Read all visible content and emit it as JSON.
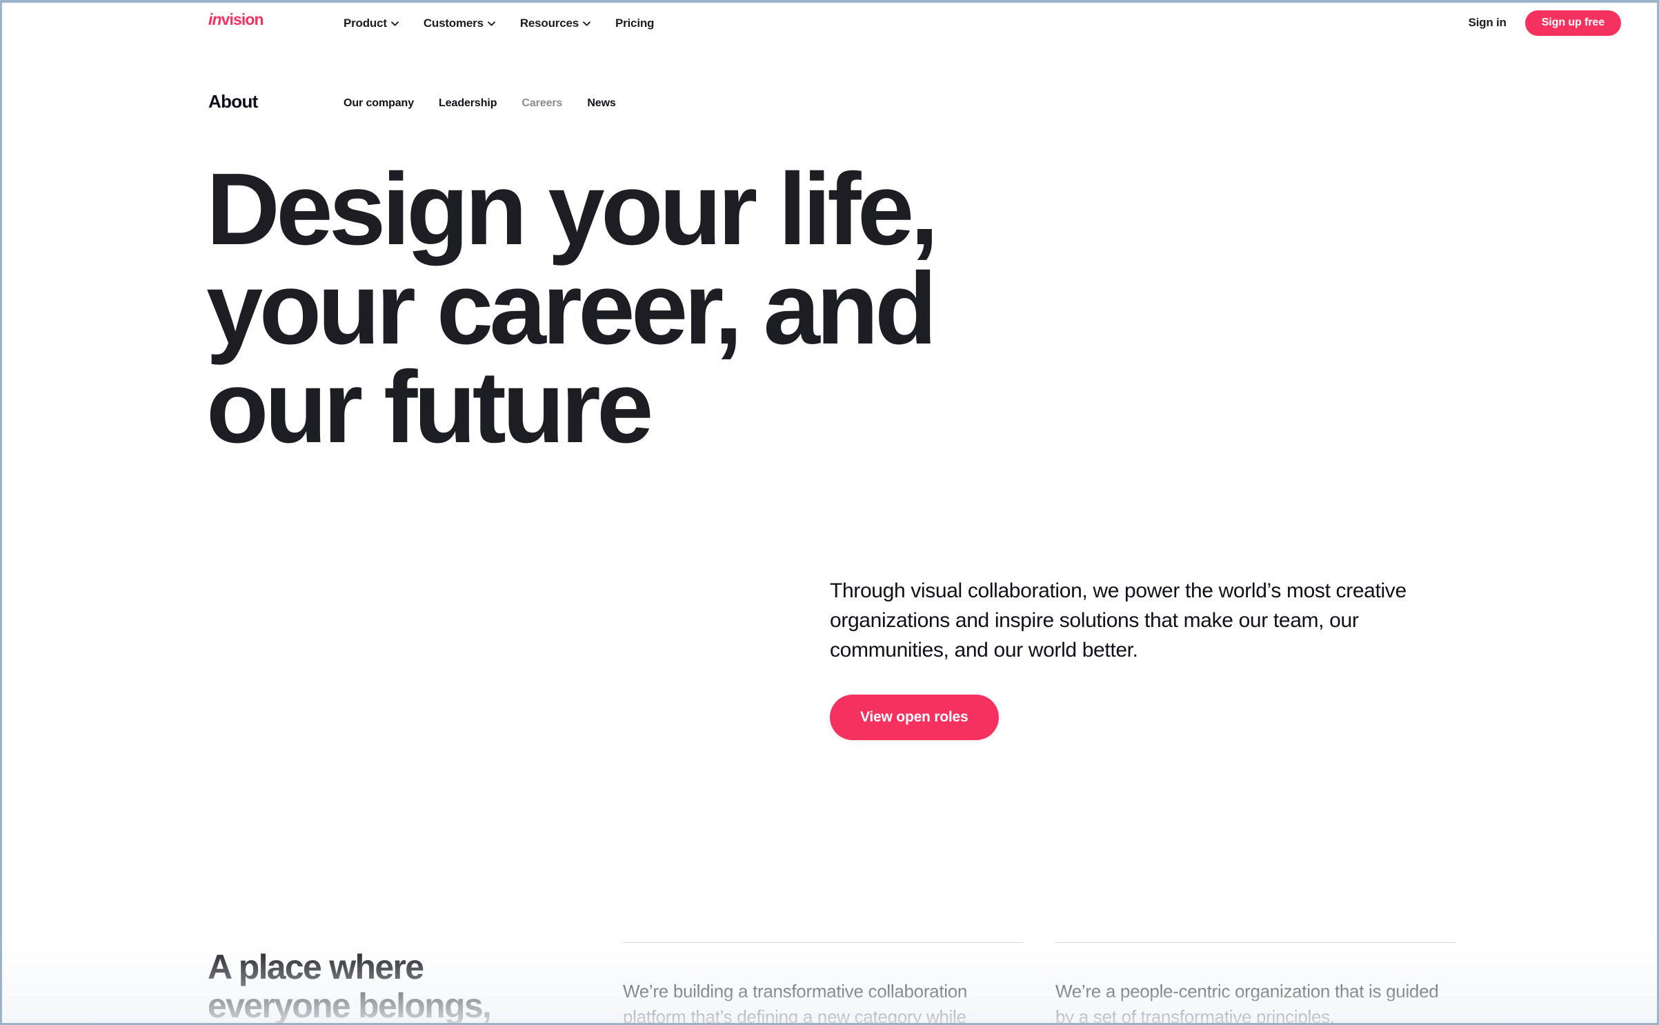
{
  "theme": {
    "brand_pink": "#f5325f",
    "text_dark": "#10101a",
    "text_muted": "#8b8b93",
    "rule": "#d5d5d9",
    "frame": "#9bb4ca"
  },
  "top_nav": {
    "logo_italic": "in",
    "logo_rest": "vision",
    "menu": [
      {
        "label": "Product",
        "has_dropdown": true
      },
      {
        "label": "Customers",
        "has_dropdown": true
      },
      {
        "label": "Resources",
        "has_dropdown": true
      },
      {
        "label": "Pricing",
        "has_dropdown": false
      }
    ],
    "sign_in": "Sign in",
    "sign_up": "Sign up free"
  },
  "sub_nav": {
    "title": "About",
    "links": [
      {
        "label": "Our company",
        "active": false
      },
      {
        "label": "Leadership",
        "active": false
      },
      {
        "label": "Careers",
        "active": true
      },
      {
        "label": "News",
        "active": false
      }
    ]
  },
  "hero": {
    "headline_lines": [
      "Design your life,",
      "your career, and",
      "our future"
    ],
    "paragraph": "Through visual collaboration, we power the world’s most creative organizations and inspire solutions that make our team, our communities, and our world better.",
    "cta_label": "View open roles"
  },
  "bottom": {
    "heading_lines": [
      "A place where",
      "everyone belongs,"
    ],
    "columns": [
      {
        "text": "We’re building a transformative collaboration platform that’s defining a new category while"
      },
      {
        "text": "We’re a people-centric organization that is guided by a set of transformative principles."
      }
    ]
  }
}
